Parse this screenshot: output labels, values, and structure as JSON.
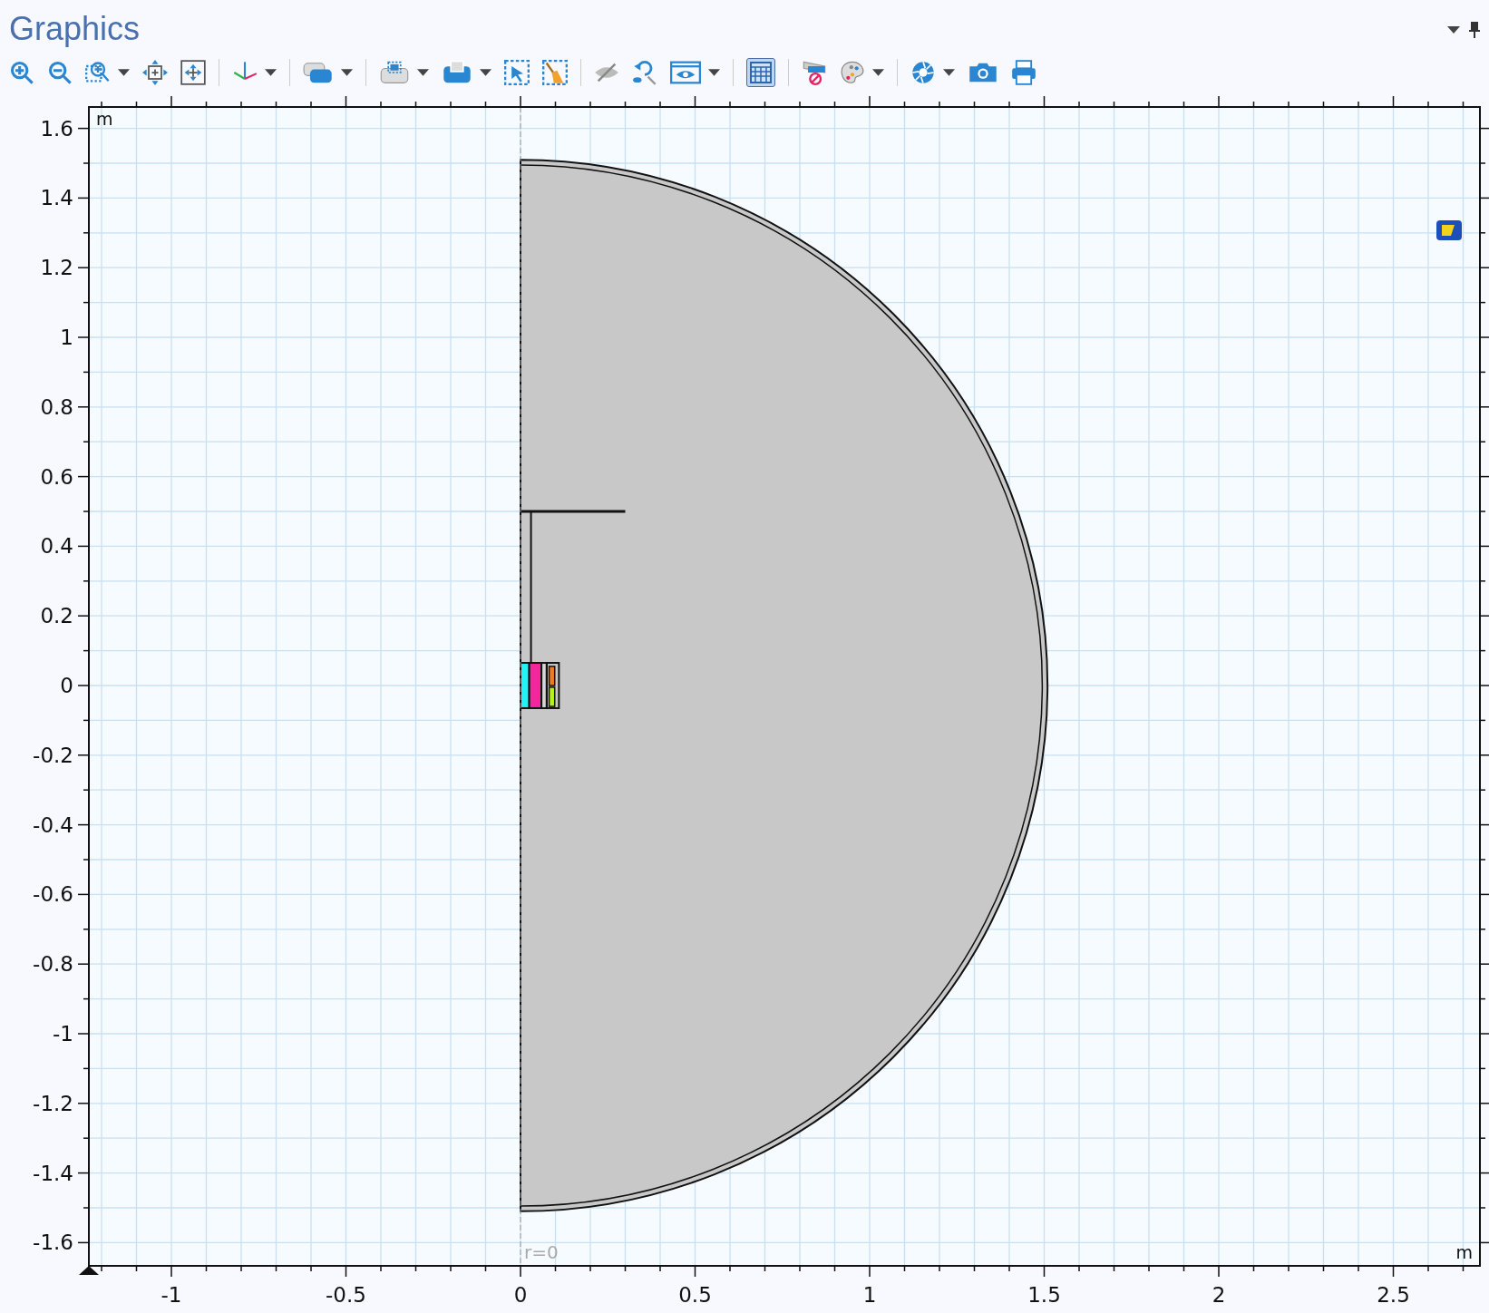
{
  "window": {
    "title": "Graphics"
  },
  "toolbar": {
    "grid_button_on": true
  },
  "plot": {
    "x_unit": "m",
    "y_unit": "m",
    "axis_label": "r=0",
    "x_tick_labels": [
      "-1",
      "-0.5",
      "0",
      "0.5",
      "1",
      "1.5",
      "2",
      "2.5"
    ],
    "y_tick_labels": [
      "1.6",
      "1.4",
      "1.2",
      "1",
      "0.8",
      "0.6",
      "0.4",
      "0.2",
      "0",
      "-0.2",
      "-0.4",
      "-0.6",
      "-0.8",
      "-1",
      "-1.2",
      "-1.4",
      "-1.6"
    ],
    "coil_domains": [
      {
        "color": "#22f4f4"
      },
      {
        "color": "#f5259b"
      },
      {
        "color": "#d6d6d6"
      }
    ],
    "small_domains": [
      {
        "color": "#f07a22"
      },
      {
        "color": "#b6f01e"
      }
    ]
  }
}
